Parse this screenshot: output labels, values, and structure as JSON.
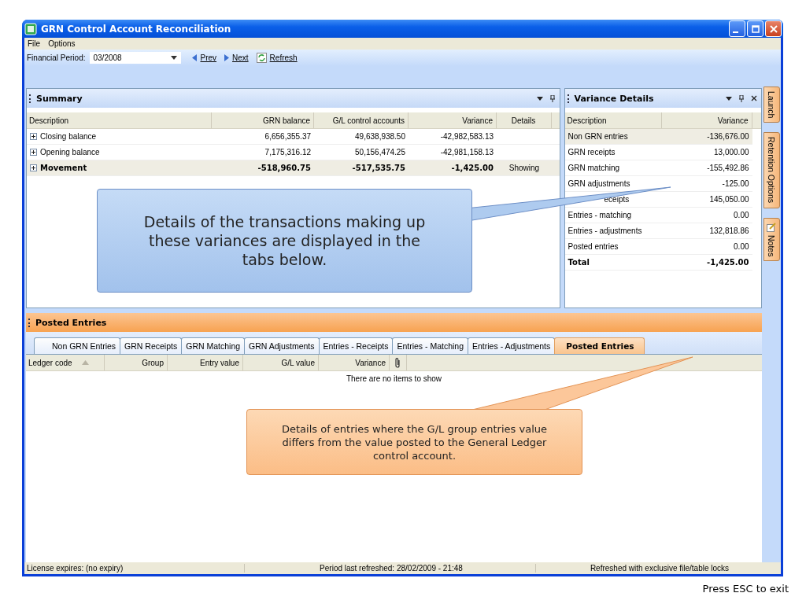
{
  "window": {
    "title": "GRN Control Account Reconciliation"
  },
  "menu": [
    "File",
    "Options"
  ],
  "toolbar": {
    "period_label": "Financial Period:",
    "period_value": "03/2008",
    "buttons": [
      {
        "kind": "prev",
        "label": "Prev"
      },
      {
        "kind": "next",
        "label": "Next"
      },
      {
        "kind": "refresh",
        "label": "Refresh"
      }
    ]
  },
  "summary": {
    "title": "Summary",
    "columns": [
      "Description",
      "GRN balance",
      "G/L control accounts",
      "Variance",
      "Details"
    ],
    "rows": [
      {
        "cells": [
          "Closing balance",
          "6,656,355.37",
          "49,638,938.50",
          "-42,982,583.13",
          ""
        ],
        "selected": false
      },
      {
        "cells": [
          "Opening balance",
          "7,175,316.12",
          "50,156,474.25",
          "-42,981,158.13",
          ""
        ],
        "selected": false
      },
      {
        "cells": [
          "Movement",
          "-518,960.75",
          "-517,535.75",
          "-1,425.00",
          "Showing"
        ],
        "selected": true
      }
    ]
  },
  "variance_details": {
    "title": "Variance Details",
    "columns": [
      "Description",
      "Variance"
    ],
    "rows": [
      {
        "kind": "item",
        "cells": [
          "Non GRN entries",
          "-136,676.00"
        ],
        "selected": true
      },
      {
        "kind": "item",
        "cells": [
          "GRN receipts",
          "13,000.00"
        ],
        "selected": false
      },
      {
        "kind": "item",
        "cells": [
          "GRN matching",
          "-155,492.86"
        ],
        "selected": false
      },
      {
        "kind": "item",
        "cells": [
          "GRN adjustments",
          "-125.00"
        ],
        "selected": false
      },
      {
        "kind": "covered",
        "cells": [
          "eceipts",
          "145,050.00"
        ],
        "selected": false
      },
      {
        "kind": "item",
        "cells": [
          "Entries - matching",
          "0.00"
        ],
        "selected": false
      },
      {
        "kind": "item",
        "cells": [
          "Entries - adjustments",
          "132,818.86"
        ],
        "selected": false
      },
      {
        "kind": "item",
        "cells": [
          "Posted entries",
          "0.00"
        ],
        "selected": false
      },
      {
        "kind": "total",
        "cells": [
          "Total",
          "-1,425.00"
        ],
        "selected": false
      }
    ]
  },
  "side_tabs": [
    {
      "label": "Launch",
      "kind": "plain"
    },
    {
      "label": "Retention Options",
      "kind": "plain"
    },
    {
      "label": "Notes",
      "kind": "note"
    }
  ],
  "posted_entries": {
    "title": "Posted Entries",
    "tabs": [
      {
        "label": "Non GRN Entries",
        "selected": false
      },
      {
        "label": "GRN Receipts",
        "selected": false
      },
      {
        "label": "GRN Matching",
        "selected": false
      },
      {
        "label": "GRN Adjustments",
        "selected": false
      },
      {
        "label": "Entries - Receipts",
        "selected": false
      },
      {
        "label": "Entries - Matching",
        "selected": false
      },
      {
        "label": "Entries - Adjustments",
        "selected": false
      },
      {
        "label": "Posted Entries",
        "selected": true
      }
    ],
    "columns": [
      "Ledger code",
      "Group",
      "Entry value",
      "G/L value",
      "Variance"
    ],
    "empty_message": "There are no items to show"
  },
  "status_bar": [
    "License expires: (no expiry)",
    "Period last refreshed: 28/02/2009 - 21:48",
    "Refreshed with exclusive file/table locks"
  ],
  "callouts": [
    {
      "kind": "blue",
      "text": "Details of the transactions making up these variances are displayed in the tabs below."
    },
    {
      "kind": "orange",
      "text": "Details of entries where the G/L group entries value differs from the value posted to the General Ledger control account."
    }
  ],
  "footer": "Press ESC to exit"
}
